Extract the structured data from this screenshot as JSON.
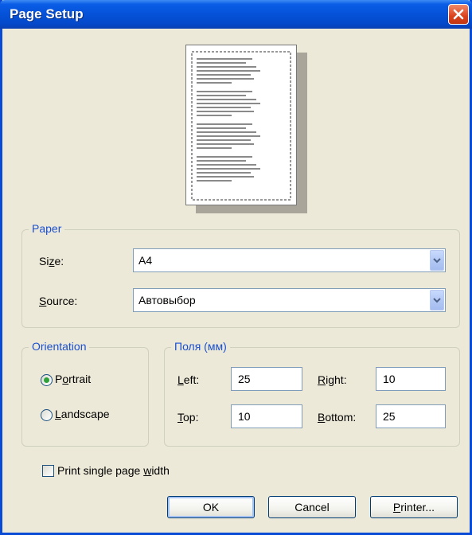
{
  "window": {
    "title": "Page Setup"
  },
  "paper": {
    "group_label": "Paper",
    "size_label": "Size:",
    "size_value": "A4",
    "source_label": "Source:",
    "source_value": "Автовыбор"
  },
  "orientation": {
    "group_label": "Orientation",
    "portrait_label": "Portrait",
    "landscape_label": "Landscape",
    "selected": "Portrait"
  },
  "margins": {
    "group_label": "Поля (мм)",
    "left_label": "Left:",
    "left_value": "25",
    "right_label": "Right:",
    "right_value": "10",
    "top_label": "Top:",
    "top_value": "10",
    "bottom_label": "Bottom:",
    "bottom_value": "25"
  },
  "options": {
    "print_single_page_width_label": "Print single page width",
    "print_single_page_width_checked": false
  },
  "buttons": {
    "ok": "OK",
    "cancel": "Cancel",
    "printer": "Printer..."
  },
  "icons": {
    "close": "close-icon",
    "dropdown": "chevron-down-icon"
  },
  "colors": {
    "titlebar": "#0552d8",
    "group_label": "#1a4fcf",
    "window_bg": "#ece9d8",
    "radio_selected": "#2fa13a",
    "close_button": "#d9431c"
  }
}
